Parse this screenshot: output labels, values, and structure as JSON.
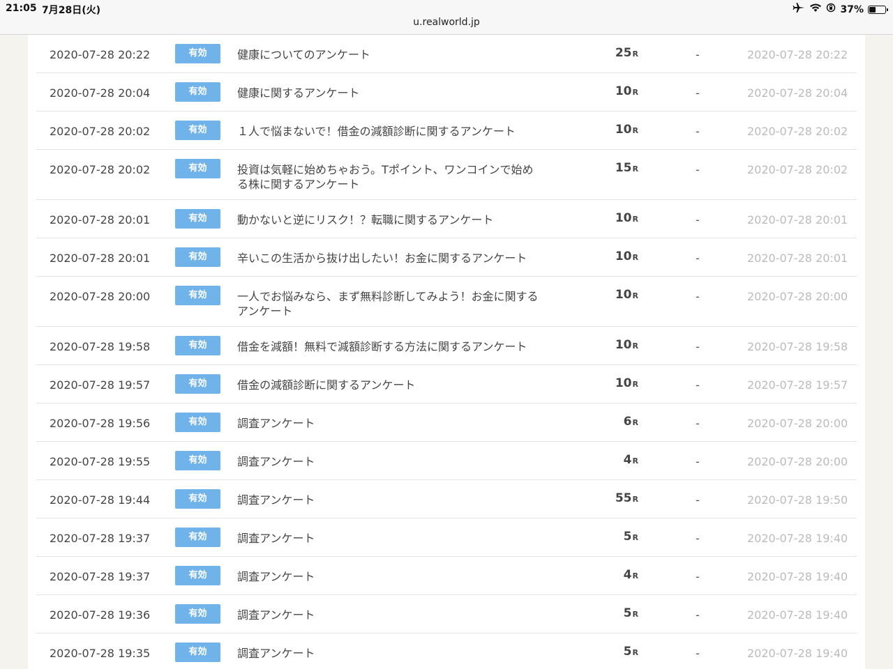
{
  "statusbar": {
    "time": "21:05",
    "date": "7月28日(火)",
    "url": "u.realworld.jp",
    "battery": "37%",
    "battery_level": 0.37,
    "icons": [
      "airplane-icon",
      "wifi-icon",
      "orientation-lock-icon",
      "battery-icon"
    ]
  },
  "colors": {
    "badge": "#6fb3ea",
    "background": "#f5f3ee"
  },
  "rows": [
    {
      "date": "2020-07-28 20:22",
      "status": "有効",
      "title": "健康についてのアンケート",
      "points": "25",
      "unit": "R",
      "dash": "-",
      "done": "2020-07-28 20:22"
    },
    {
      "date": "2020-07-28 20:04",
      "status": "有効",
      "title": "健康に関するアンケート",
      "points": "10",
      "unit": "R",
      "dash": "-",
      "done": "2020-07-28 20:04"
    },
    {
      "date": "2020-07-28 20:02",
      "status": "有効",
      "title": "１人で悩まないで！借金の減額診断に関するアンケート",
      "points": "10",
      "unit": "R",
      "dash": "-",
      "done": "2020-07-28 20:02"
    },
    {
      "date": "2020-07-28 20:02",
      "status": "有効",
      "title": "投資は気軽に始めちゃおう。Tポイント、ワンコインで始める株に関するアンケート",
      "points": "15",
      "unit": "R",
      "dash": "-",
      "done": "2020-07-28 20:02"
    },
    {
      "date": "2020-07-28 20:01",
      "status": "有効",
      "title": "動かないと逆にリスク！？転職に関するアンケート",
      "points": "10",
      "unit": "R",
      "dash": "-",
      "done": "2020-07-28 20:01"
    },
    {
      "date": "2020-07-28 20:01",
      "status": "有効",
      "title": "辛いこの生活から抜け出したい！お金に関するアンケート",
      "points": "10",
      "unit": "R",
      "dash": "-",
      "done": "2020-07-28 20:01"
    },
    {
      "date": "2020-07-28 20:00",
      "status": "有効",
      "title": "一人でお悩みなら、まず無料診断してみよう！お金に関するアンケート",
      "points": "10",
      "unit": "R",
      "dash": "-",
      "done": "2020-07-28 20:00"
    },
    {
      "date": "2020-07-28 19:58",
      "status": "有効",
      "title": "借金を減額！無料で減額診断する方法に関するアンケート",
      "points": "10",
      "unit": "R",
      "dash": "-",
      "done": "2020-07-28 19:58"
    },
    {
      "date": "2020-07-28 19:57",
      "status": "有効",
      "title": "借金の減額診断に関するアンケート",
      "points": "10",
      "unit": "R",
      "dash": "-",
      "done": "2020-07-28 19:57"
    },
    {
      "date": "2020-07-28 19:56",
      "status": "有効",
      "title": "調査アンケート",
      "points": "6",
      "unit": "R",
      "dash": "-",
      "done": "2020-07-28 20:00"
    },
    {
      "date": "2020-07-28 19:55",
      "status": "有効",
      "title": "調査アンケート",
      "points": "4",
      "unit": "R",
      "dash": "-",
      "done": "2020-07-28 20:00"
    },
    {
      "date": "2020-07-28 19:44",
      "status": "有効",
      "title": "調査アンケート",
      "points": "55",
      "unit": "R",
      "dash": "-",
      "done": "2020-07-28 19:50"
    },
    {
      "date": "2020-07-28 19:37",
      "status": "有効",
      "title": "調査アンケート",
      "points": "5",
      "unit": "R",
      "dash": "-",
      "done": "2020-07-28 19:40"
    },
    {
      "date": "2020-07-28 19:37",
      "status": "有効",
      "title": "調査アンケート",
      "points": "4",
      "unit": "R",
      "dash": "-",
      "done": "2020-07-28 19:40"
    },
    {
      "date": "2020-07-28 19:36",
      "status": "有効",
      "title": "調査アンケート",
      "points": "5",
      "unit": "R",
      "dash": "-",
      "done": "2020-07-28 19:40"
    },
    {
      "date": "2020-07-28 19:35",
      "status": "有効",
      "title": "調査アンケート",
      "points": "5",
      "unit": "R",
      "dash": "-",
      "done": "2020-07-28 19:40"
    }
  ]
}
